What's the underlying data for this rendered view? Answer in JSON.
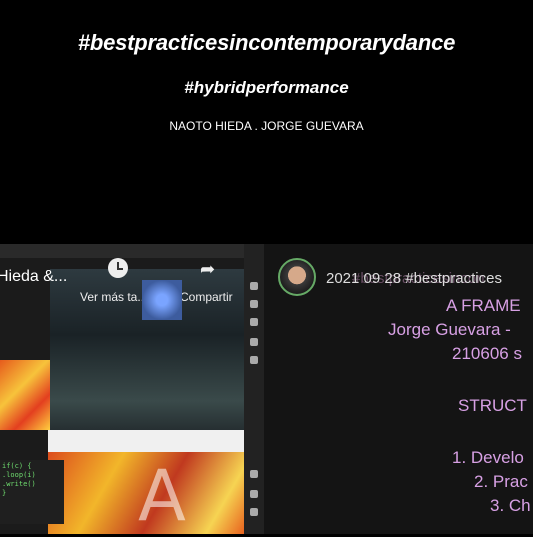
{
  "header": {
    "hashtag_main": "#bestpracticesincontemporarydance",
    "hashtag_sub": "#hybridperformance",
    "authors": "NAOTO HIEDA . JORGE GUEVARA"
  },
  "video": {
    "title_fragment": "Hieda &...",
    "watch_later": "Ver más ta...",
    "share": "Compartir"
  },
  "chat": {
    "date_line": "2021 09 28 #bestpractices",
    "ghost_line": "#bestpracticesincon",
    "lines": [
      "A FRAME",
      "Jorge Guevara -",
      "210606 s",
      "STRUCT",
      "1. Develo",
      "2. Prac",
      "3. Ch"
    ]
  }
}
